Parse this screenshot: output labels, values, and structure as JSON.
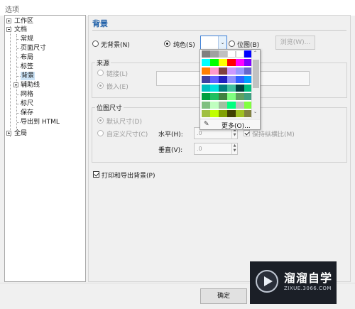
{
  "window": {
    "title": "选项"
  },
  "tree": {
    "items": [
      {
        "label": "工作区",
        "level": 0,
        "expander": "plus"
      },
      {
        "label": "文档",
        "level": 0,
        "expander": "minus"
      },
      {
        "label": "常规",
        "level": 1
      },
      {
        "label": "页面尺寸",
        "level": 1
      },
      {
        "label": "布局",
        "level": 1
      },
      {
        "label": "标签",
        "level": 1
      },
      {
        "label": "背景",
        "level": 1,
        "selected": true
      },
      {
        "label": "辅助线",
        "level": 1,
        "expander": "plus"
      },
      {
        "label": "网格",
        "level": 1
      },
      {
        "label": "标尺",
        "level": 1
      },
      {
        "label": "保存",
        "level": 1
      },
      {
        "label": "导出到 HTML",
        "level": 1
      },
      {
        "label": "全局",
        "level": 0,
        "expander": "plus"
      }
    ]
  },
  "panel": {
    "title": "背景",
    "bg_type": {
      "none": "无背景(N)",
      "solid": "纯色(S)",
      "bitmap": "位图(B)",
      "browse": "浏览(W)...",
      "selected": "solid"
    },
    "source": {
      "title": "来源",
      "link": "链接(L)",
      "embed": "嵌入(E)"
    },
    "bitmap_size": {
      "title": "位图尺寸",
      "default": "默认尺寸(D)",
      "custom": "自定义尺寸(C)",
      "horizontal_label": "水平(H):",
      "horizontal_value": ".0",
      "vertical_label": "垂直(V):",
      "vertical_value": ".0",
      "keep_ratio": "保持纵横比(M)"
    },
    "print_export": {
      "label": "打印和导出背景(P)",
      "checked": true
    }
  },
  "color_popup": {
    "more": "更多(O)...",
    "eyedropper_icon": "eyedropper-icon",
    "colors": [
      "#808080",
      "#a0a0a0",
      "#c0c0c0",
      "#ffffff",
      "#ffffff",
      "#0000ff",
      "#00ffff",
      "#00ff00",
      "#ffff00",
      "#ff0000",
      "#ff00ff",
      "#8000ff",
      "#ff8000",
      "#ff99cc",
      "#804040",
      "#cc99ff",
      "#9999ff",
      "#6666cc",
      "#4040a0",
      "#6060ff",
      "#2020c0",
      "#9090ff",
      "#3060ff",
      "#00a0ff",
      "#00c0c0",
      "#00e0e0",
      "#008080",
      "#40c0a0",
      "#004040",
      "#00c080",
      "#00a040",
      "#20c060",
      "#408040",
      "#80ff80",
      "#60a060",
      "#40a080",
      "#80c080",
      "#c0ffc0",
      "#a0c0a0",
      "#00ff80",
      "#c0c0c0",
      "#80ff40",
      "#a0c040",
      "#c0ff00",
      "#80a000",
      "#404000",
      "#a0c020",
      "#808040"
    ]
  },
  "footer": {
    "ok": "确定"
  },
  "watermark": {
    "brand": "溜溜自学",
    "url": "ZIXUE.3066.COM"
  }
}
